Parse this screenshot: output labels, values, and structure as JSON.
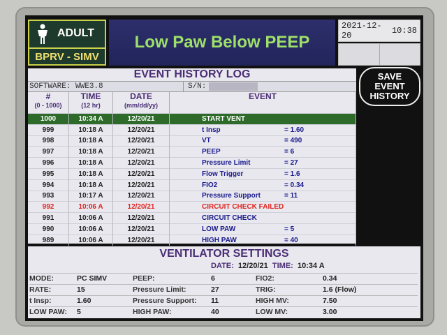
{
  "header": {
    "patient_type": "ADULT",
    "mode": "BPRV - SIMV",
    "alarm": "Low Paw Below PEEP",
    "date": "2021-12-20",
    "time": "10:38"
  },
  "event_log": {
    "title": "EVENT HISTORY LOG",
    "software": "SOFTWARE: WWE3.8",
    "sn_label": "S/N:",
    "columns": [
      {
        "label": "#",
        "sub": "(0 - 1000)"
      },
      {
        "label": "TIME",
        "sub": "(12 hr)"
      },
      {
        "label": "DATE",
        "sub": "(mm/dd/yy)"
      },
      {
        "label": "EVENT",
        "sub": ""
      }
    ],
    "rows": [
      {
        "num": "1000",
        "time": "10:34 A",
        "date": "12/20/21",
        "event": "START VENT",
        "value": ""
      },
      {
        "num": "999",
        "time": "10:18 A",
        "date": "12/20/21",
        "event": "t Insp",
        "value": "= 1.60"
      },
      {
        "num": "998",
        "time": "10:18 A",
        "date": "12/20/21",
        "event": "VT",
        "value": "= 490"
      },
      {
        "num": "997",
        "time": "10:18 A",
        "date": "12/20/21",
        "event": "PEEP",
        "value": "= 6"
      },
      {
        "num": "996",
        "time": "10:18 A",
        "date": "12/20/21",
        "event": "Pressure Limit",
        "value": "= 27"
      },
      {
        "num": "995",
        "time": "10:18 A",
        "date": "12/20/21",
        "event": "Flow Trigger",
        "value": "= 1.6"
      },
      {
        "num": "994",
        "time": "10:18 A",
        "date": "12/20/21",
        "event": "FIO2",
        "value": "= 0.34"
      },
      {
        "num": "993",
        "time": "10:17 A",
        "date": "12/20/21",
        "event": "Pressure Support",
        "value": "= 11"
      },
      {
        "num": "992",
        "time": "10:06 A",
        "date": "12/20/21",
        "event": "CIRCUIT CHECK FAILED",
        "value": ""
      },
      {
        "num": "991",
        "time": "10:06 A",
        "date": "12/20/21",
        "event": "CIRCUIT CHECK",
        "value": ""
      },
      {
        "num": "990",
        "time": "10:06 A",
        "date": "12/20/21",
        "event": "LOW PAW",
        "value": "= 5"
      },
      {
        "num": "989",
        "time": "10:06 A",
        "date": "12/20/21",
        "event": "HIGH PAW",
        "value": "= 40"
      }
    ]
  },
  "save_button": {
    "line1": "SAVE",
    "line2": "EVENT",
    "line3": "HISTORY"
  },
  "settings": {
    "title": "VENTILATOR SETTINGS",
    "date_label": "DATE:",
    "date": "12/20/21",
    "time_label": "TIME:",
    "time": "10:34 A",
    "rows": [
      [
        {
          "label": "MODE:",
          "value": "PC SIMV"
        },
        {
          "label": "PEEP:",
          "value": "6"
        },
        {
          "label": "FIO2:",
          "value": "0.34"
        }
      ],
      [
        {
          "label": "RATE:",
          "value": "15"
        },
        {
          "label": "Pressure Limit:",
          "value": "27"
        },
        {
          "label": "TRIG:",
          "value": "1.6 (Flow)"
        }
      ],
      [
        {
          "label": "t Insp:",
          "value": "1.60"
        },
        {
          "label": "Pressure Support:",
          "value": "11"
        },
        {
          "label": "HIGH MV:",
          "value": "7.50"
        }
      ],
      [
        {
          "label": "LOW PAW:",
          "value": "5"
        },
        {
          "label": "HIGH PAW:",
          "value": "40"
        },
        {
          "label": "LOW MV:",
          "value": "3.00"
        }
      ]
    ]
  },
  "icons": {
    "patient": "person-icon"
  },
  "colors": {
    "banner": "#2c2f6a",
    "alarm_text": "#9ee06a",
    "highlight_row": "#2e6b2a",
    "failed_event": "#e0241e",
    "title_purple": "#4a2d74"
  }
}
